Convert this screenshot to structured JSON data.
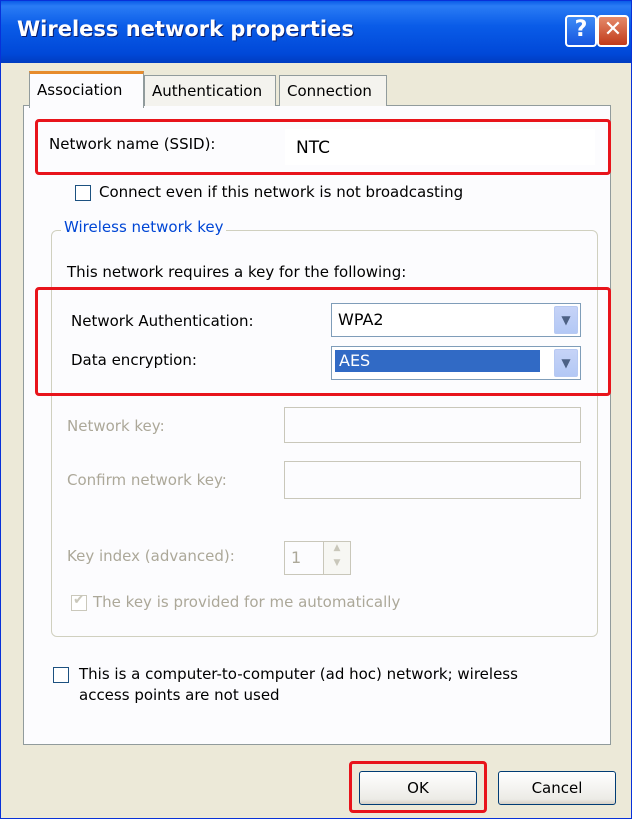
{
  "window": {
    "title": "Wireless network properties"
  },
  "titlebar": {
    "help_glyph": "?",
    "close_glyph": "✕"
  },
  "tabs": [
    {
      "label": "Association",
      "active": true
    },
    {
      "label": "Authentication"
    },
    {
      "label": "Connection"
    }
  ],
  "ssid": {
    "label": "Network name (SSID):",
    "value": "NTC"
  },
  "broadcast_checkbox": {
    "label": "Connect even if this network is not broadcasting",
    "checked": false
  },
  "key_group": {
    "title": "Wireless network key",
    "intro": "This network requires a key for the following:",
    "auth": {
      "label": "Network Authentication:",
      "value": "WPA2"
    },
    "encryption": {
      "label": "Data encryption:",
      "value": "AES"
    },
    "network_key": {
      "label": "Network key:",
      "value": ""
    },
    "confirm_key": {
      "label": "Confirm network key:",
      "value": ""
    },
    "key_index": {
      "label": "Key index (advanced):",
      "value": "1"
    },
    "auto_key": {
      "label": "The key is provided for me automatically",
      "checked": true
    }
  },
  "adhoc_checkbox": {
    "line1": "This is a computer-to-computer (ad hoc) network; wireless",
    "line2": "access points are not used",
    "checked": false
  },
  "buttons": {
    "ok": "OK",
    "cancel": "Cancel"
  },
  "colors": {
    "highlight_red": "#e8141b",
    "selection_blue": "#316ac5",
    "group_title": "#0046d5"
  }
}
